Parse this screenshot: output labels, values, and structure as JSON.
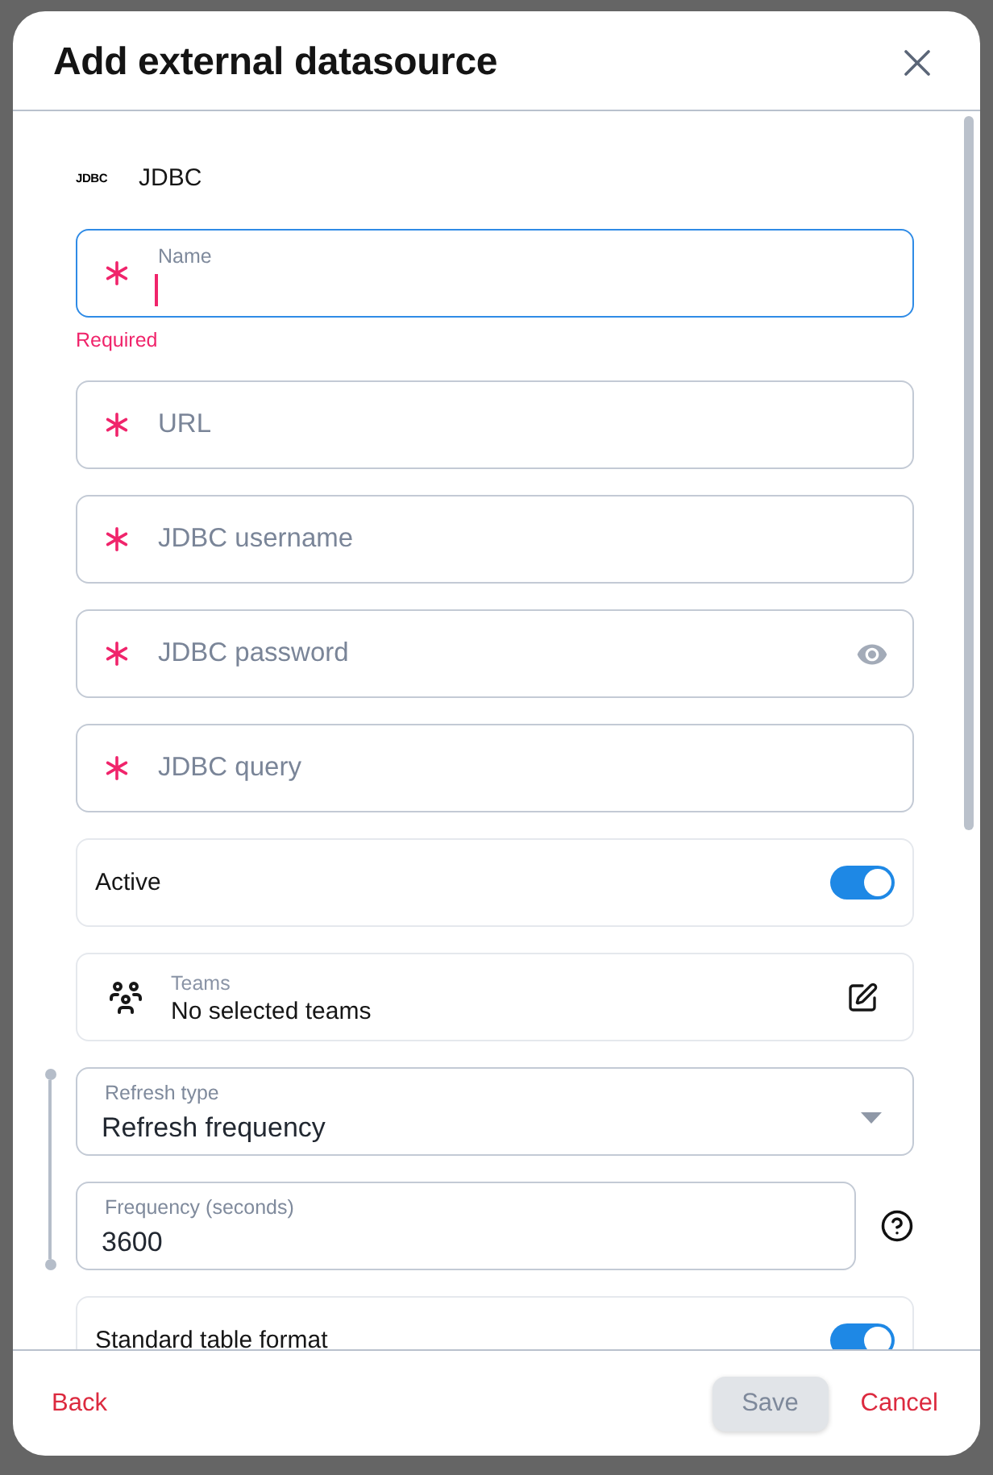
{
  "dialog": {
    "title": "Add external datasource"
  },
  "source": {
    "logo": "JDBC",
    "name": "JDBC"
  },
  "fields": [
    {
      "kind": "text",
      "label": "Name",
      "required": true,
      "focused": true,
      "error": "Required"
    },
    {
      "kind": "text",
      "label": "URL",
      "required": true,
      "focused": false
    },
    {
      "kind": "text",
      "label": "JDBC username",
      "required": true,
      "focused": false
    },
    {
      "kind": "password",
      "label": "JDBC password",
      "required": true,
      "focused": false
    },
    {
      "kind": "text",
      "label": "JDBC query",
      "required": true,
      "focused": false
    }
  ],
  "active": {
    "label": "Active",
    "on": true
  },
  "teams": {
    "label": "Teams",
    "value": "No selected teams"
  },
  "refresh": {
    "type": {
      "label": "Refresh type",
      "value": "Refresh frequency"
    },
    "frequency": {
      "label": "Frequency (seconds)",
      "value": "3600"
    }
  },
  "table_format": {
    "label": "Standard table format",
    "on": true
  },
  "footer": {
    "back": "Back",
    "save": {
      "label": "Save",
      "disabled": true
    },
    "cancel": "Cancel"
  }
}
